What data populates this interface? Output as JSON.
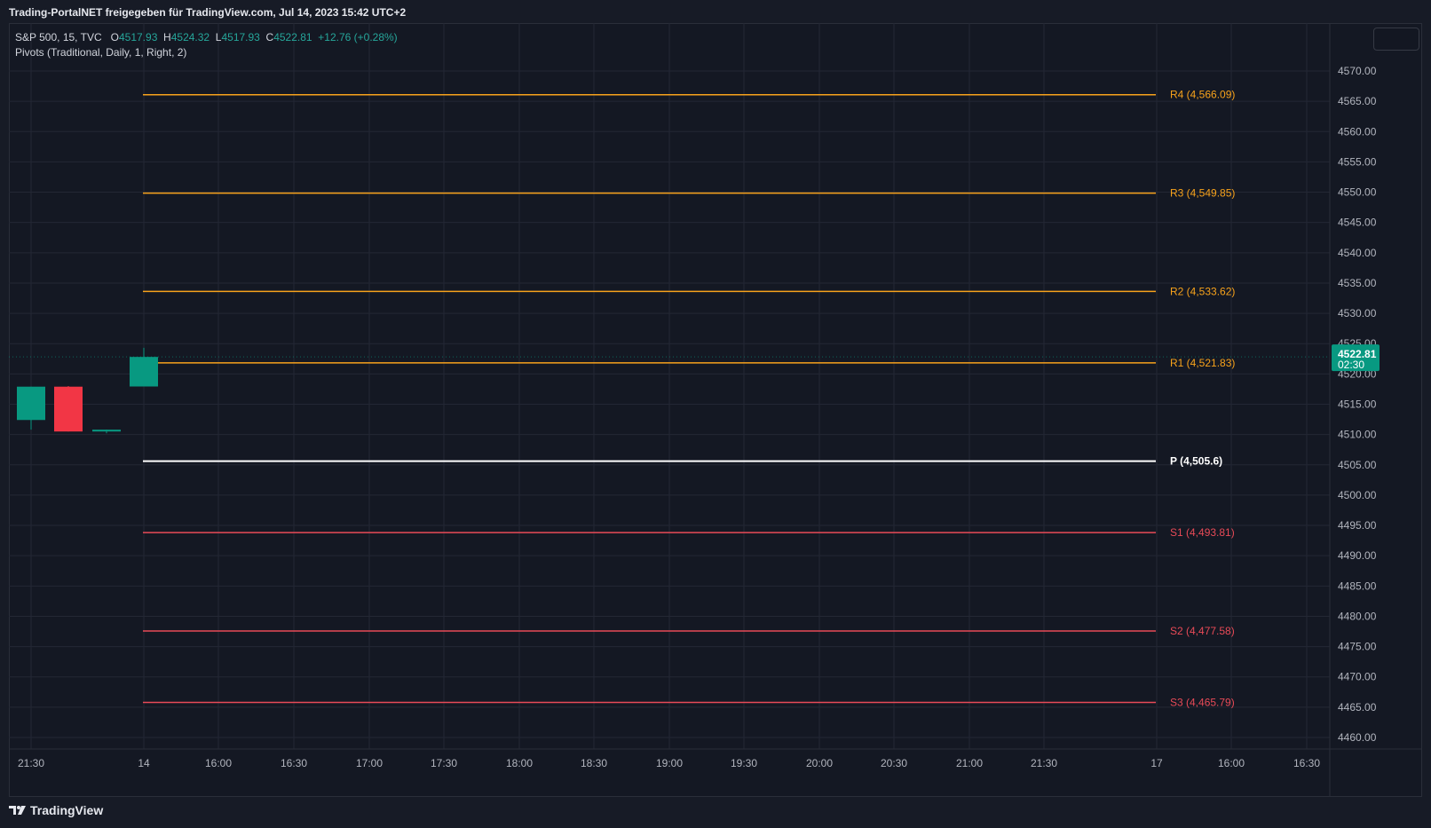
{
  "caption": "Trading-PortalNET freigegeben für TradingView.com, Jul 14, 2023 15:42 UTC+2",
  "legend": {
    "symbol": "S&P 500, 15, TVC",
    "open_label": "O",
    "open": "4517.93",
    "high_label": "H",
    "high": "4524.32",
    "low_label": "L",
    "low": "4517.93",
    "close_label": "C",
    "close": "4522.81",
    "change": "+12.76 (+0.28%)",
    "indicator": "Pivots (Traditional, Daily, 1, Right, 2)"
  },
  "price_badge": {
    "price": "4522.81",
    "countdown": "02:30",
    "color": "#089981"
  },
  "footer": {
    "brand": "TradingView",
    "logo_icon": "tradingview-logo-icon"
  },
  "colors": {
    "background": "#171b26",
    "grid": "#232734",
    "up": "#089981",
    "down": "#f23645",
    "resistance": "#f7a21b",
    "pivot": "#ffffff",
    "support": "#e84a57"
  },
  "chart_data": {
    "type": "candlestick",
    "timeframe": "15",
    "ylim": [
      4457.5,
      4575.0
    ],
    "y_ticks": [
      4460,
      4465,
      4470,
      4475,
      4480,
      4485,
      4490,
      4495,
      4500,
      4505,
      4510,
      4515,
      4520,
      4525,
      4530,
      4535,
      4540,
      4545,
      4550,
      4555,
      4560,
      4565,
      4570
    ],
    "y_tick_labels": [
      "4460.00",
      "4465.00",
      "4470.00",
      "4475.00",
      "4480.00",
      "4485.00",
      "4490.00",
      "4495.00",
      "4500.00",
      "4505.00",
      "4510.00",
      "4515.00",
      "4520.00",
      "4525.00",
      "4530.00",
      "4535.00",
      "4540.00",
      "4545.00",
      "4550.00",
      "4555.00",
      "4560.00",
      "4565.00",
      "4570.00"
    ],
    "x_ticks": [
      "21:30",
      "14",
      "16:00",
      "16:30",
      "17:00",
      "17:30",
      "18:00",
      "18:30",
      "19:00",
      "19:30",
      "20:00",
      "20:30",
      "21:00",
      "21:30",
      "17",
      "16:00",
      "16:30"
    ],
    "candles": [
      {
        "time": "21:30",
        "open": 4512.4,
        "high": 4517.9,
        "low": 4510.8,
        "close": 4517.9
      },
      {
        "time": "21:45",
        "open": 4517.9,
        "high": 4518.0,
        "low": 4510.5,
        "close": 4510.5
      },
      {
        "time": "22:00",
        "open": 4510.5,
        "high": 4510.8,
        "low": 4510.2,
        "close": 4510.8
      },
      {
        "time": "14 15:30",
        "open": 4517.93,
        "high": 4524.32,
        "low": 4517.93,
        "close": 4522.81
      }
    ],
    "pivots": [
      {
        "name": "R4",
        "value": 4566.09,
        "label": "R4 (4,566.09)",
        "color": "#f7a21b"
      },
      {
        "name": "R3",
        "value": 4549.85,
        "label": "R3 (4,549.85)",
        "color": "#f7a21b"
      },
      {
        "name": "R2",
        "value": 4533.62,
        "label": "R2 (4,533.62)",
        "color": "#f7a21b"
      },
      {
        "name": "R1",
        "value": 4521.83,
        "label": "R1 (4,521.83)",
        "color": "#f7a21b"
      },
      {
        "name": "P",
        "value": 4505.6,
        "label": "P (4,505.6)",
        "color": "#ffffff"
      },
      {
        "name": "S1",
        "value": 4493.81,
        "label": "S1 (4,493.81)",
        "color": "#e84a57"
      },
      {
        "name": "S2",
        "value": 4477.58,
        "label": "S2 (4,477.58)",
        "color": "#e84a57"
      },
      {
        "name": "S3",
        "value": 4465.79,
        "label": "S3 (4,465.79)",
        "color": "#e84a57"
      }
    ]
  }
}
